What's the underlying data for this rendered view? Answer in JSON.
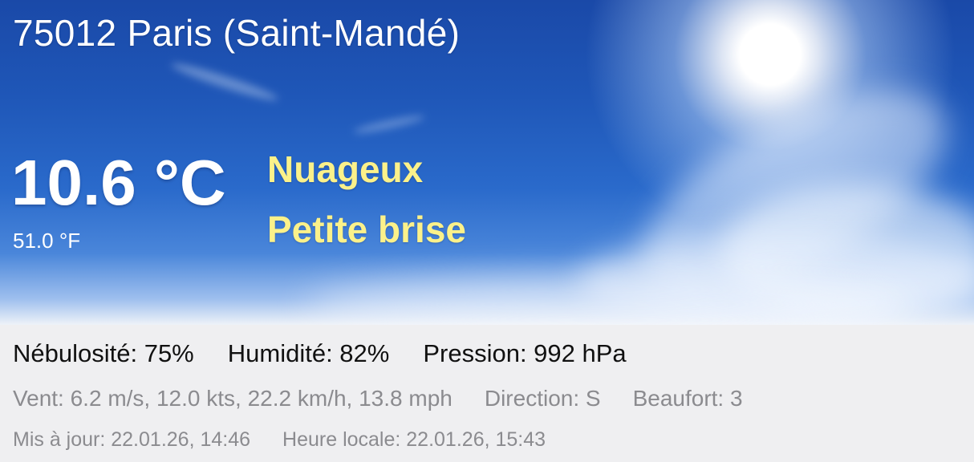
{
  "location": "75012 Paris (Saint-Mandé)",
  "temperature": {
    "celsius": "10.6 °C",
    "fahrenheit": "51.0 °F"
  },
  "condition": "Nuageux",
  "wind_description": "Petite brise",
  "details": {
    "cloud_cover": "Nébulosité: 75%",
    "humidity": "Humidité: 82%",
    "pressure": "Pression: 992 hPa",
    "wind": "Vent: 6.2 m/s, 12.0 kts, 22.2 km/h, 13.8 mph",
    "direction": "Direction: S",
    "beaufort": "Beaufort: 3",
    "updated": "Mis à jour: 22.01.26, 14:46",
    "local_time": "Heure locale: 22.01.26, 15:43"
  },
  "colors": {
    "condition_text": "#fbf18a",
    "primary_text": "#111111",
    "secondary_text": "#8b8b8f",
    "sky": "#1f57b8"
  }
}
